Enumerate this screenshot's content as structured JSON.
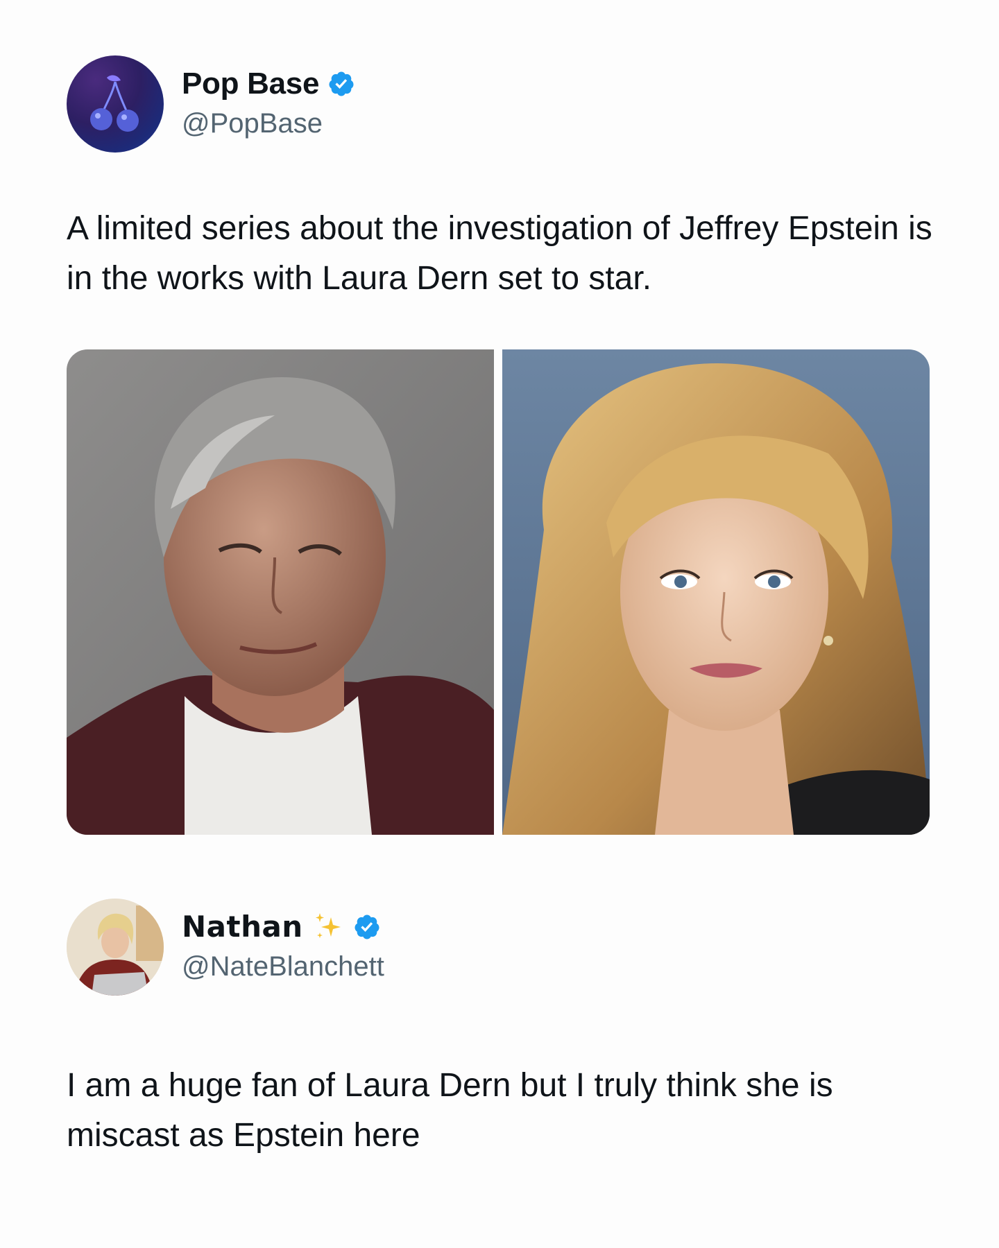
{
  "posts": [
    {
      "author": {
        "display_name": "Pop Base",
        "handle": "@PopBase",
        "verified": true,
        "avatar_icon": "cherry-logo-icon"
      },
      "text": "A limited series about the investigation of Jeffrey Epstein is in the works with Laura Dern set to star.",
      "media": [
        {
          "name": "photo-left",
          "subject": "man-portrait"
        },
        {
          "name": "photo-right",
          "subject": "woman-portrait"
        }
      ]
    },
    {
      "author": {
        "display_name": "Nathan",
        "handle": "@NateBlanchett",
        "verified": true,
        "emoji": "✨",
        "avatar_icon": "profile-photo"
      },
      "text": "I am a huge fan of Laura Dern but I truly think she is miscast as Epstein here"
    }
  ],
  "colors": {
    "background": "#fdfdfd",
    "text": "#0f1419",
    "handle": "#536471",
    "verified_badge": "#1d9bf0"
  }
}
